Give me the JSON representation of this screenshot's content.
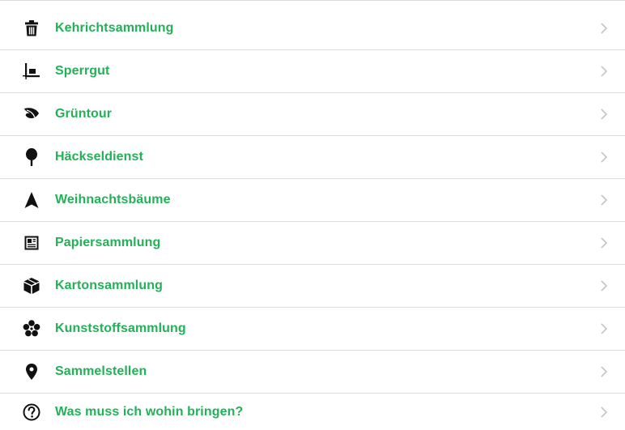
{
  "colors": {
    "accent": "#21b157",
    "icon": "#111111",
    "divider": "#dcdcdc",
    "chevron": "#c4c4c4"
  },
  "items": [
    {
      "label": "Kehrichtsammlung",
      "icon": "trash-icon"
    },
    {
      "label": "Sperrgut",
      "icon": "crop-icon"
    },
    {
      "label": "Grüntour",
      "icon": "leaf-icon"
    },
    {
      "label": "Häckseldienst",
      "icon": "tree-icon"
    },
    {
      "label": "Weihnachtsbäume",
      "icon": "navigation-arrow-icon"
    },
    {
      "label": "Papiersammlung",
      "icon": "newspaper-icon"
    },
    {
      "label": "Kartonsammlung",
      "icon": "box-icon"
    },
    {
      "label": "Kunststoffsammlung",
      "icon": "flower-icon"
    },
    {
      "label": "Sammelstellen",
      "icon": "map-pin-icon"
    },
    {
      "label": "Was muss ich wohin bringen?",
      "icon": "question-circle-icon"
    }
  ]
}
